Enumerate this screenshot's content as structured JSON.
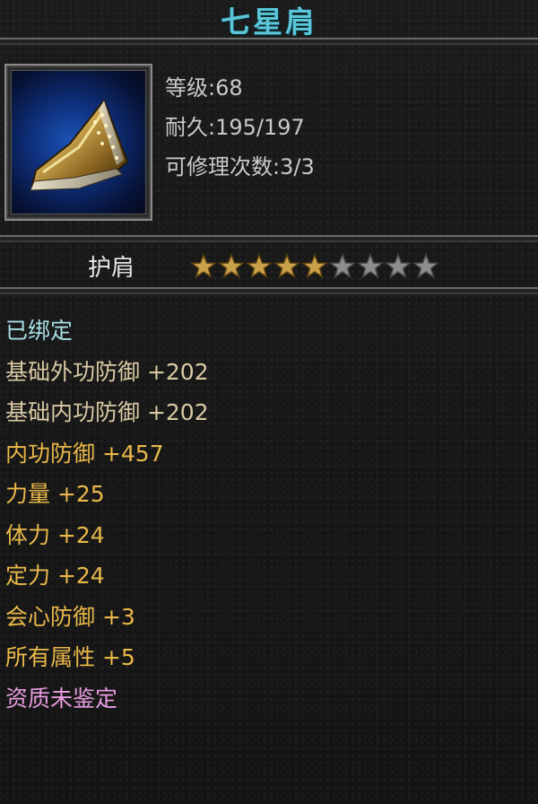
{
  "title": "七星肩",
  "stats": {
    "level": "等级:68",
    "durability": "耐久:195/197",
    "repairs": "可修理次数:3/3"
  },
  "item_type": "护肩",
  "rating": {
    "stars_filled": 5,
    "stars_total": 9
  },
  "icon": "shoulder-armor-icon",
  "attributes": [
    {
      "text": "已绑定",
      "color": "#a8dde6"
    },
    {
      "text": "基础外功防御 +202",
      "color": "#d9c9a4"
    },
    {
      "text": "基础内功防御 +202",
      "color": "#d9c9a4"
    },
    {
      "text": "内功防御 +457",
      "color": "#e9b84a"
    },
    {
      "text": "力量 +25",
      "color": "#e9b84a"
    },
    {
      "text": "体力 +24",
      "color": "#e9b84a"
    },
    {
      "text": "定力 +24",
      "color": "#e9b84a"
    },
    {
      "text": "会心防御 +3",
      "color": "#e9b84a"
    },
    {
      "text": "所有属性 +5",
      "color": "#e9b84a"
    },
    {
      "text": "资质未鉴定",
      "color": "#e79ce0"
    }
  ]
}
